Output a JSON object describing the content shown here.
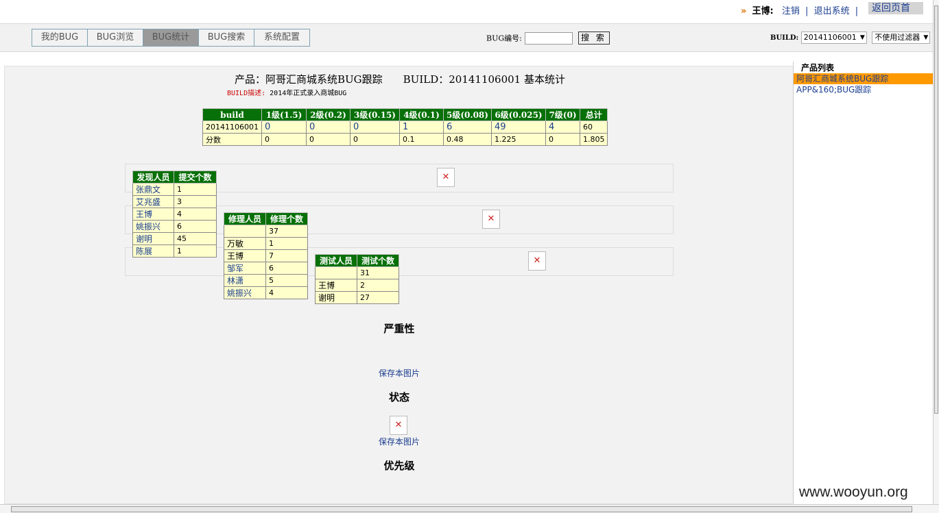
{
  "user": {
    "name": "王博:",
    "logout": "注销",
    "exit": "退出系统",
    "back": "返回页首"
  },
  "nav": {
    "tabs": [
      "我的BUG",
      "BUG浏览",
      "BUG统计",
      "BUG搜索",
      "系统配置"
    ],
    "active_tab": "BUG统计",
    "bug_id_label": "BUG编号:",
    "bug_id_value": "",
    "search_button": "搜 索",
    "build_label": "BUILD:",
    "build_value": "20141106001",
    "filter_value": "不使用过滤器"
  },
  "report": {
    "title_product": "产品：阿哥汇商城系统BUG跟踪",
    "title_build": "BUILD：20141106001 基本统计",
    "desc_key": "BUILD描述:",
    "desc_value": "2014年正式录入商城BUG"
  },
  "summary_table": {
    "headers": [
      "build",
      "1级(1.5)",
      "2级(0.2)",
      "3级(0.15)",
      "4级(0.1)",
      "5级(0.08)",
      "6级(0.025)",
      "7级(0)",
      "总计"
    ],
    "rows": [
      [
        "20141106001",
        "0",
        "0",
        "0",
        "1",
        "6",
        "49",
        "4",
        "60"
      ],
      [
        "分数",
        "0",
        "0",
        "0",
        "0.1",
        "0.48",
        "1.225",
        "0",
        "1.805"
      ]
    ]
  },
  "finder_table": {
    "headers": [
      "发现人员",
      "提交个数"
    ],
    "rows": [
      [
        "张鼎文",
        "1"
      ],
      [
        "艾兆盛",
        "3"
      ],
      [
        "王博",
        "4"
      ],
      [
        "姚振兴",
        "6"
      ],
      [
        "谢明",
        "45"
      ],
      [
        "陈展",
        "1"
      ]
    ]
  },
  "fixer_table": {
    "headers": [
      "修理人员",
      "修理个数"
    ],
    "rows": [
      [
        "",
        "37"
      ],
      [
        "万敏",
        "1"
      ],
      [
        "王博",
        "7"
      ],
      [
        "邹军",
        "6"
      ],
      [
        "林潇",
        "5"
      ],
      [
        "姚振兴",
        "4"
      ]
    ]
  },
  "tester_table": {
    "headers": [
      "测试人员",
      "测试个数"
    ],
    "rows": [
      [
        "",
        "31"
      ],
      [
        "王博",
        "2"
      ],
      [
        "谢明",
        "27"
      ]
    ]
  },
  "sections": {
    "severity": "严重性",
    "status": "状态",
    "priority": "优先级",
    "save_image": "保存本图片"
  },
  "sidebar": {
    "header": "产品列表",
    "items": [
      "阿哥汇商城系统BUG跟踪",
      "APP&160;BUG跟踪"
    ]
  },
  "watermark": "www.wooyun.org",
  "broken_image_glyph": "✕",
  "colors": {
    "table_header": "#087008",
    "table_cell": "#ffffcc",
    "sidebar_active": "#ff9900",
    "link": "#1a3d8f"
  }
}
